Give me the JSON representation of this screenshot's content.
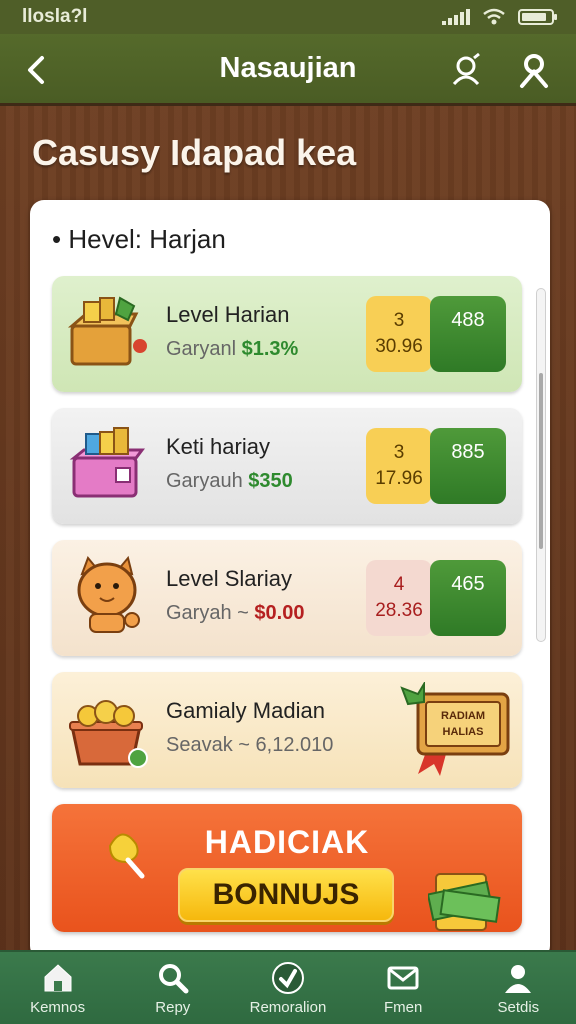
{
  "status": {
    "time": "llosla?l"
  },
  "appbar": {
    "title": "Nasaujian"
  },
  "heading": "Casusy Idapad kea",
  "panel": {
    "subtitle": "Hevel: Harjan"
  },
  "rows": [
    {
      "title": "Level Harian",
      "sub_label": "Garyanl",
      "sub_amount": "$1.3%",
      "amount_color": "#2e8a2e",
      "badge_top": "3",
      "badge_bottom": "30.96",
      "badge_green": "488"
    },
    {
      "title": "Keti hariay",
      "sub_label": "Garyauh",
      "sub_amount": "$350",
      "amount_color": "#2e8a2e",
      "badge_top": "3",
      "badge_bottom": "17.96",
      "badge_green": "885"
    },
    {
      "title": "Level Slariay",
      "sub_label": "Garyah ~",
      "sub_amount": "$0.00",
      "amount_color": "#b52020",
      "badge_top": "4",
      "badge_bottom": "28.36",
      "badge_green": "465"
    },
    {
      "title": "Gamialy Madian",
      "sub_label": "Seavak ~",
      "sub_amount": "6,12.010",
      "amount_color": "#666666",
      "tag_text": "RADIAM HALIAS"
    }
  ],
  "bonus": {
    "title": "HADICIAK",
    "button": "BONNUJS"
  },
  "nav": [
    {
      "label": "Kemnos",
      "icon": "home-icon"
    },
    {
      "label": "Repy",
      "icon": "search-icon"
    },
    {
      "label": "Remoralion",
      "icon": "badge-icon"
    },
    {
      "label": "Fmen",
      "icon": "mail-icon"
    },
    {
      "label": "Setdis",
      "icon": "profile-icon"
    }
  ],
  "colors": {
    "appbar": "#4f5e28",
    "nav": "#3b7a4c",
    "accent_green": "#2f7a26",
    "bonus": "#e9531d"
  }
}
